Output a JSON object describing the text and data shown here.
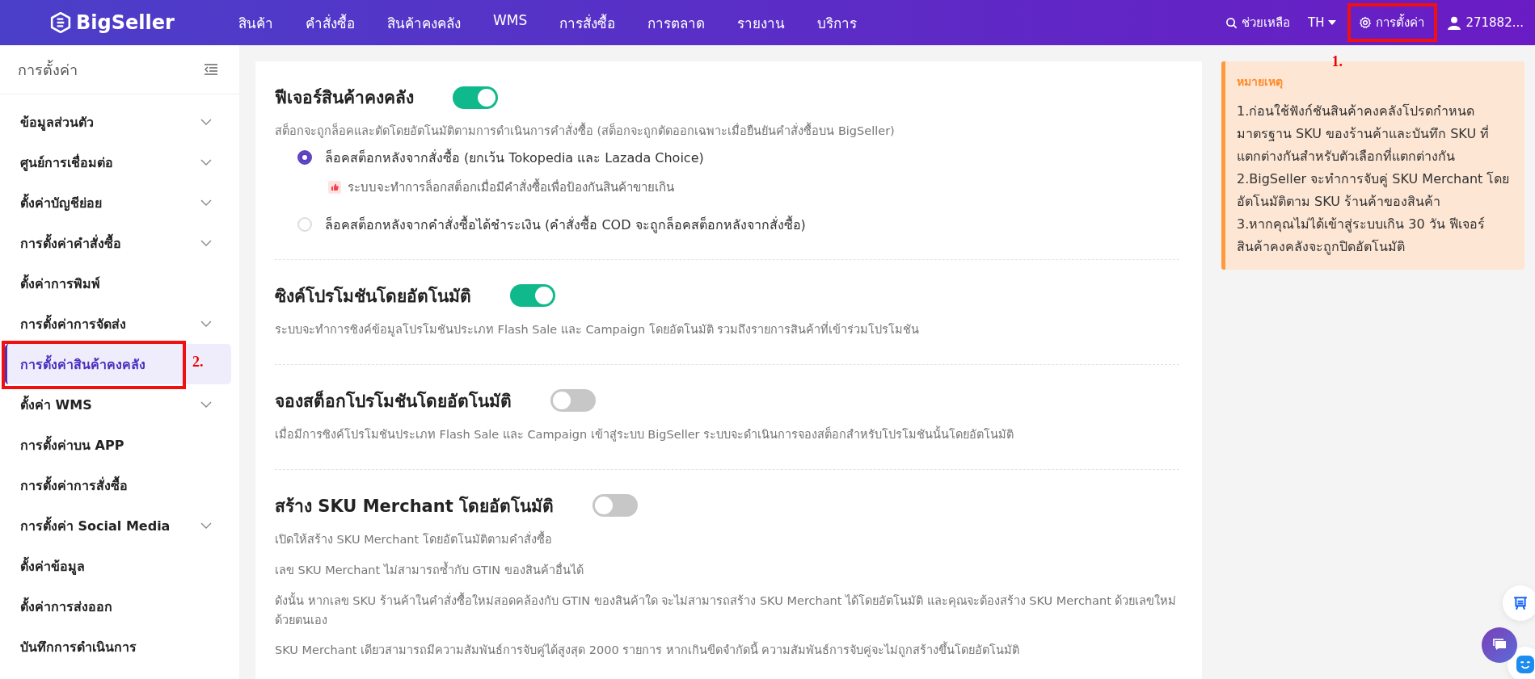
{
  "header": {
    "logo": "BigSeller",
    "nav": [
      "สินค้า",
      "คำสั่งซื้อ",
      "สินค้าคงคลัง",
      "WMS",
      "การสั่งซื้อ",
      "การตลาด",
      "รายงาน",
      "บริการ"
    ],
    "help": "ช่วยเหลือ",
    "language": "TH",
    "settings": {
      "label": "การตั้งค่า",
      "annotation": "1."
    },
    "user": "271882..."
  },
  "sidebar": {
    "title": "การตั้งค่า",
    "items": [
      {
        "label": "ข้อมูลส่วนตัว",
        "expandable": true,
        "selected": false
      },
      {
        "label": "ศูนย์การเชื่อมต่อ",
        "expandable": true,
        "selected": false
      },
      {
        "label": "ตั้งค่าบัญชีย่อย",
        "expandable": true,
        "selected": false
      },
      {
        "label": "การตั้งค่าคำสั่งซื้อ",
        "expandable": true,
        "selected": false
      },
      {
        "label": "ตั้งค่าการพิมพ์",
        "expandable": false,
        "selected": false
      },
      {
        "label": "การตั้งค่าการจัดส่ง",
        "expandable": true,
        "selected": false
      },
      {
        "label": "การตั้งค่าสินค้าคงคลัง",
        "expandable": false,
        "selected": true,
        "annotation": "2."
      },
      {
        "label": "ตั้งค่า WMS",
        "expandable": true,
        "selected": false
      },
      {
        "label": "การตั้งค่าบน APP",
        "expandable": false,
        "selected": false
      },
      {
        "label": "การตั้งค่าการสั่งซื้อ",
        "expandable": false,
        "selected": false
      },
      {
        "label": "การตั้งค่า Social Media",
        "expandable": true,
        "selected": false
      },
      {
        "label": "ตั้งค่าข้อมูล",
        "expandable": false,
        "selected": false
      },
      {
        "label": "ตั้งค่าการส่งออก",
        "expandable": false,
        "selected": false
      },
      {
        "label": "บันทึกการดำเนินการ",
        "expandable": false,
        "selected": false
      }
    ]
  },
  "sections": [
    {
      "title": "ฟีเจอร์สินค้าคงคลัง",
      "on": true,
      "description": [
        "สต็อกจะถูกล็อคและตัดโดยอัตโนมัติตามการดำเนินการคำสั่งซื้อ (สต็อกจะถูกตัดออกเฉพาะเมื่อยืนยันคำสั่งซื้อบน BigSeller)"
      ],
      "options": [
        {
          "label": "ล็อคสต็อกหลังจากสั่งซื้อ (ยกเว้น Tokopedia และ Lazada Choice)",
          "selected": true,
          "hint": "ระบบจะทำการล็อกสต็อกเมื่อมีคำสั่งซื้อเพื่อป้องกันสินค้าขายเกิน"
        },
        {
          "label": "ล็อคสต็อกหลังจากคำสั่งซื้อได้ชำระเงิน (คำสั่งซื้อ COD จะถูกล็อคสต็อกหลังจากสั่งซื้อ)",
          "selected": false
        }
      ]
    },
    {
      "title": "ซิงค์โปรโมชันโดยอัตโนมัติ",
      "on": true,
      "description": [
        "ระบบจะทำการซิงค์ข้อมูลโปรโมชันประเภท Flash Sale และ Campaign โดยอัตโนมัติ รวมถึงรายการสินค้าที่เข้าร่วมโปรโมชัน"
      ]
    },
    {
      "title": "จองสต็อกโปรโมชันโดยอัตโนมัติ",
      "on": false,
      "description": [
        "เมื่อมีการซิงค์โปรโมชันประเภท Flash Sale และ Campaign เข้าสู่ระบบ BigSeller ระบบจะดำเนินการจองสต็อกสำหรับโปรโมชันนั้นโดยอัตโนมัติ"
      ]
    },
    {
      "title": "สร้าง SKU Merchant โดยอัตโนมัติ",
      "on": false,
      "description": [
        "เปิดให้สร้าง SKU Merchant โดยอัตโนมัติตามคำสั่งซื้อ",
        "เลข SKU Merchant ไม่สามารถซ้ำกับ GTIN ของสินค้าอื่นได้",
        "ดังนั้น หากเลข SKU ร้านค้าในคำสั่งซื้อใหม่สอดคล้องกับ GTIN ของสินค้าใด จะไม่สามารถสร้าง SKU Merchant ได้โดยอัตโนมัติ และคุณจะต้องสร้าง SKU Merchant ด้วยเลขใหม่ด้วยตนเอง",
        "SKU Merchant เดียวสามารถมีความสัมพันธ์การจับคู่ได้สูงสุด 2000 รายการ หากเกินขีดจำกัดนี้ ความสัมพันธ์การจับคู่จะไม่ถูกสร้างขึ้นโดยอัตโนมัติ"
      ]
    }
  ],
  "note": {
    "title": "หมายเหตุ",
    "lines": [
      "1.ก่อนใช้ฟังก์ชันสินค้าคงคลังโปรดกำหนดมาตรฐาน SKU ของร้านค้าและบันทึก SKU ที่แตกต่างกันสำหรับตัวเลือกที่แตกต่างกัน",
      "2.BigSeller จะทำการจับคู่ SKU Merchant โดยอัตโนมัติตาม SKU ร้านค้าของสินค้า",
      "3.หากคุณไม่ได้เข้าสู่ระบบเกิน 30 วัน ฟีเจอร์สินค้าคงคลังจะถูกปิดอัตโนมัติ"
    ]
  }
}
